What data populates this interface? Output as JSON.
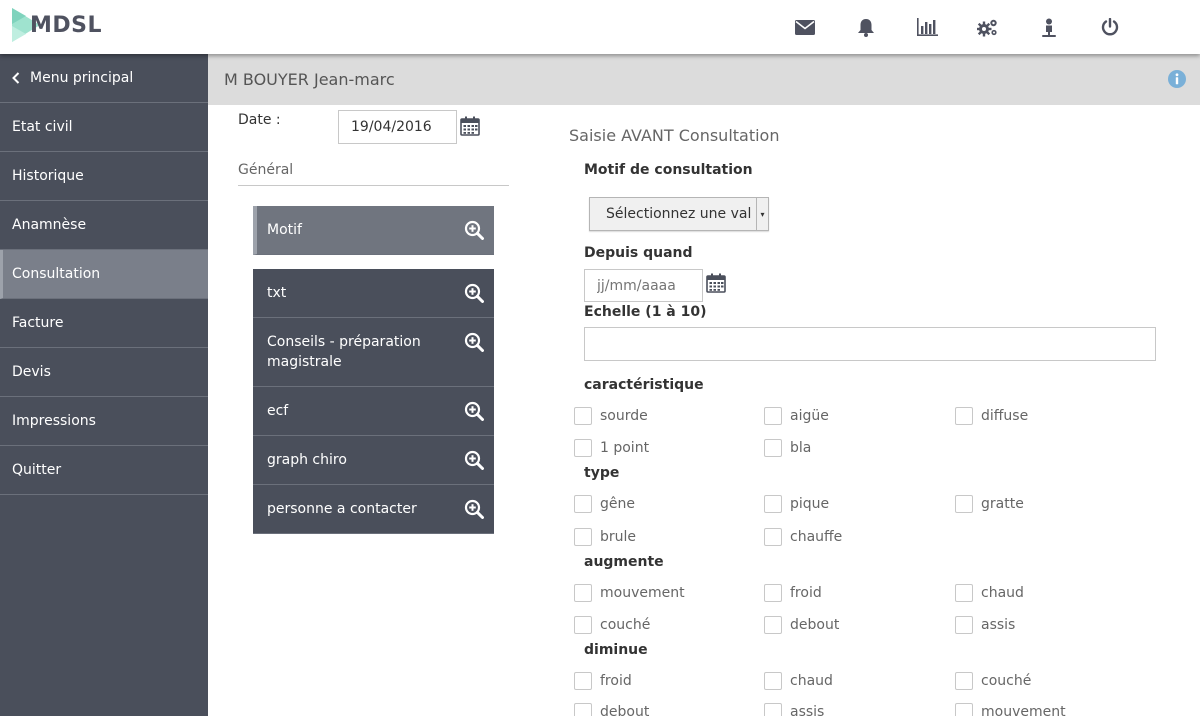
{
  "app": {
    "logo_text": "MDSL"
  },
  "topbar": {
    "icons": [
      "envelope-icon",
      "bell-icon",
      "bar-chart-icon",
      "cogs-icon",
      "user-icon",
      "power-icon"
    ]
  },
  "sidebar": {
    "back_label": "Menu principal",
    "items": [
      {
        "label": "Etat civil"
      },
      {
        "label": "Historique"
      },
      {
        "label": "Anamnèse"
      },
      {
        "label": "Consultation",
        "active": true
      },
      {
        "label": "Facture"
      },
      {
        "label": "Devis"
      },
      {
        "label": "Impressions"
      },
      {
        "label": "Quitter"
      }
    ]
  },
  "patient": {
    "name": "M BOUYER Jean-marc"
  },
  "left": {
    "date_label": "Date :",
    "date_value": "19/04/2016",
    "general_title": "Général",
    "cards": [
      {
        "label": "Motif"
      },
      {
        "label": "txt"
      },
      {
        "label": "Conseils - préparation magistrale"
      },
      {
        "label": "ecf"
      },
      {
        "label": "graph chiro"
      },
      {
        "label": "personne a contacter"
      }
    ]
  },
  "form": {
    "title": "Saisie AVANT Consultation",
    "motif_label": "Motif de consultation",
    "motif_select": "Sélectionnez une val",
    "depuis_label": "Depuis quand",
    "depuis_placeholder": "jj/mm/aaaa",
    "echelle_label": "Echelle (1 à 10)",
    "echelle_value": "",
    "sections": [
      {
        "label": "caractéristique",
        "options": [
          "sourde",
          "aigüe",
          "diffuse",
          "1 point",
          "bla"
        ]
      },
      {
        "label": "type",
        "options": [
          "gêne",
          "pique",
          "gratte",
          "brule",
          "chauffe"
        ]
      },
      {
        "label": "augmente",
        "options": [
          "mouvement",
          "froid",
          "chaud",
          "couché",
          "debout",
          "assis"
        ]
      },
      {
        "label": "diminue",
        "options": [
          "froid",
          "chaud",
          "couché",
          "debout",
          "assis",
          "mouvement"
        ]
      }
    ]
  }
}
